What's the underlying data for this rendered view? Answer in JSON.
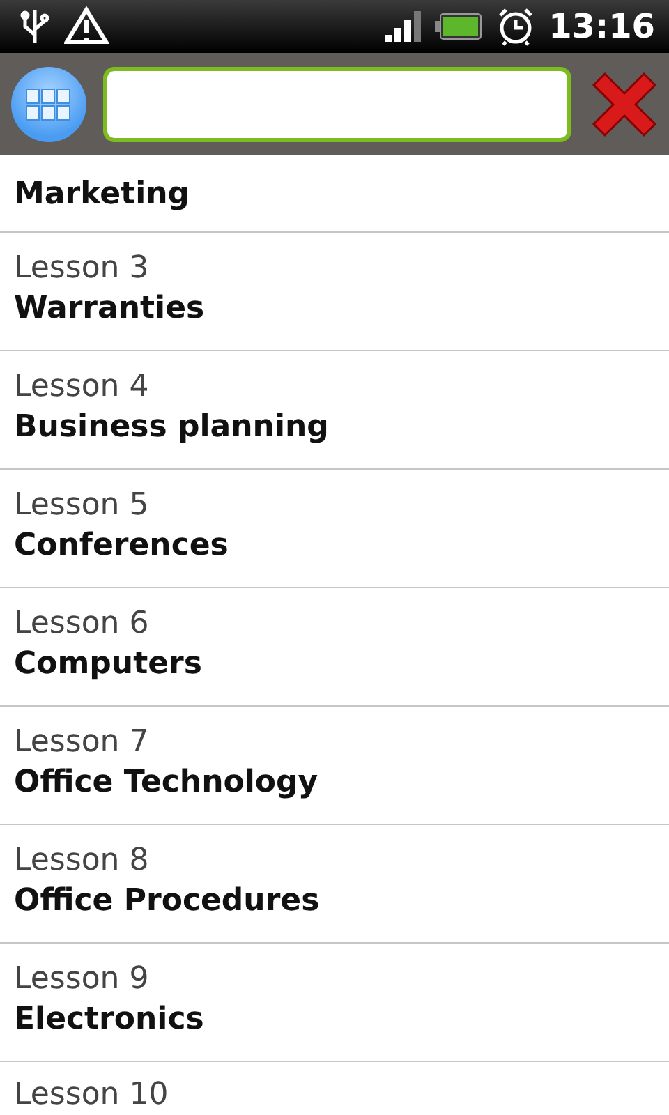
{
  "status_bar": {
    "time": "13:16"
  },
  "search": {
    "focused": true
  },
  "lessons": [
    {
      "title": "Marketing"
    },
    {
      "label": "Lesson 3",
      "title": "Warranties"
    },
    {
      "label": "Lesson 4",
      "title": "Business planning"
    },
    {
      "label": "Lesson 5",
      "title": "Conferences"
    },
    {
      "label": "Lesson 6",
      "title": "Computers"
    },
    {
      "label": "Lesson 7",
      "title": "Office Technology"
    },
    {
      "label": "Lesson 8",
      "title": "Office Procedures"
    },
    {
      "label": "Lesson 9",
      "title": "Electronics"
    },
    {
      "label": "Lesson 10"
    }
  ]
}
